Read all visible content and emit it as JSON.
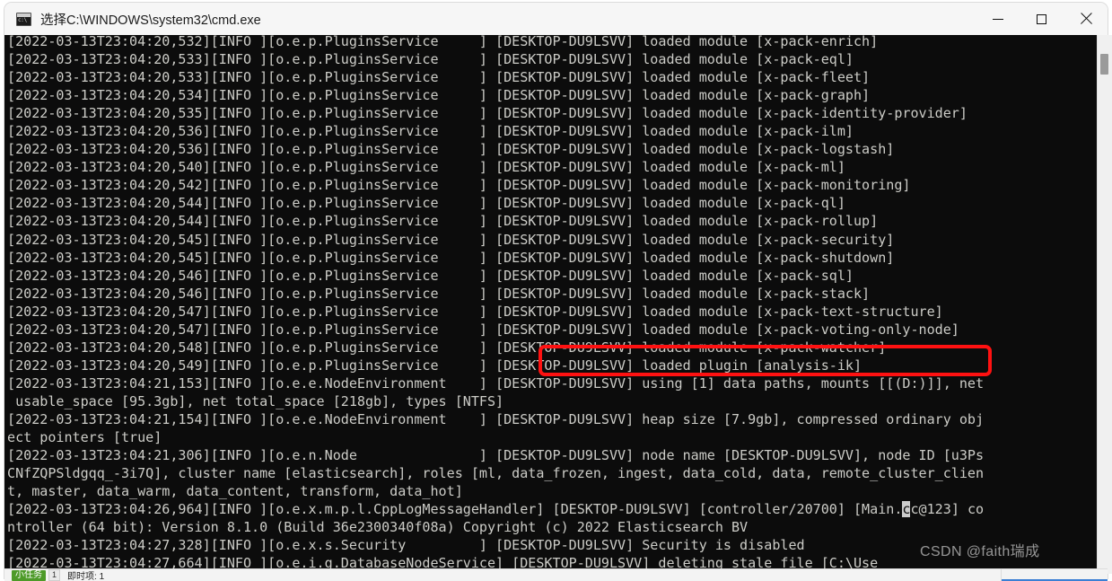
{
  "window": {
    "title": "选择C:\\WINDOWS\\system32\\cmd.exe",
    "icon": "cmd-icon",
    "controls": {
      "minimize_label": "Minimize",
      "maximize_label": "Maximize",
      "close_label": "Close"
    }
  },
  "colors": {
    "console_background": "#0c0c0c",
    "console_foreground": "#ccccc7",
    "titlebar_background": "#f6f6f6",
    "annotation_red": "#ff1111",
    "scrollbar_thumb": "#9a9a9a"
  },
  "annotation": {
    "type": "red-rectangle",
    "highlights_text": "[DESKTOP-DU9LSVV] loaded plugin [analysis-ik]",
    "color": "#ff1111"
  },
  "watermark": {
    "text": "CSDN @faith瑞成"
  },
  "scrollbar": {
    "position": "near-top",
    "thumb_top_pct": 4
  },
  "bottom_strip": {
    "status_label": "小任务",
    "count": "1",
    "items_label": "即时项: 1"
  },
  "console": {
    "hostname": "DESKTOP-DU9LSVV",
    "lines": [
      "[2022-03-13T23:04:20,532][INFO ][o.e.p.PluginsService     ] [DESKTOP-DU9LSVV] loaded module [x-pack-enrich]",
      "[2022-03-13T23:04:20,533][INFO ][o.e.p.PluginsService     ] [DESKTOP-DU9LSVV] loaded module [x-pack-eql]",
      "[2022-03-13T23:04:20,533][INFO ][o.e.p.PluginsService     ] [DESKTOP-DU9LSVV] loaded module [x-pack-fleet]",
      "[2022-03-13T23:04:20,534][INFO ][o.e.p.PluginsService     ] [DESKTOP-DU9LSVV] loaded module [x-pack-graph]",
      "[2022-03-13T23:04:20,535][INFO ][o.e.p.PluginsService     ] [DESKTOP-DU9LSVV] loaded module [x-pack-identity-provider]",
      "[2022-03-13T23:04:20,536][INFO ][o.e.p.PluginsService     ] [DESKTOP-DU9LSVV] loaded module [x-pack-ilm]",
      "[2022-03-13T23:04:20,536][INFO ][o.e.p.PluginsService     ] [DESKTOP-DU9LSVV] loaded module [x-pack-logstash]",
      "[2022-03-13T23:04:20,540][INFO ][o.e.p.PluginsService     ] [DESKTOP-DU9LSVV] loaded module [x-pack-ml]",
      "[2022-03-13T23:04:20,542][INFO ][o.e.p.PluginsService     ] [DESKTOP-DU9LSVV] loaded module [x-pack-monitoring]",
      "[2022-03-13T23:04:20,544][INFO ][o.e.p.PluginsService     ] [DESKTOP-DU9LSVV] loaded module [x-pack-ql]",
      "[2022-03-13T23:04:20,544][INFO ][o.e.p.PluginsService     ] [DESKTOP-DU9LSVV] loaded module [x-pack-rollup]",
      "[2022-03-13T23:04:20,545][INFO ][o.e.p.PluginsService     ] [DESKTOP-DU9LSVV] loaded module [x-pack-security]",
      "[2022-03-13T23:04:20,545][INFO ][o.e.p.PluginsService     ] [DESKTOP-DU9LSVV] loaded module [x-pack-shutdown]",
      "[2022-03-13T23:04:20,546][INFO ][o.e.p.PluginsService     ] [DESKTOP-DU9LSVV] loaded module [x-pack-sql]",
      "[2022-03-13T23:04:20,546][INFO ][o.e.p.PluginsService     ] [DESKTOP-DU9LSVV] loaded module [x-pack-stack]",
      "[2022-03-13T23:04:20,547][INFO ][o.e.p.PluginsService     ] [DESKTOP-DU9LSVV] loaded module [x-pack-text-structure]",
      "[2022-03-13T23:04:20,547][INFO ][o.e.p.PluginsService     ] [DESKTOP-DU9LSVV] loaded module [x-pack-voting-only-node]",
      "[2022-03-13T23:04:20,548][INFO ][o.e.p.PluginsService     ] [DESKTOP-DU9LSVV] loaded module [x-pack-watcher]",
      "[2022-03-13T23:04:20,549][INFO ][o.e.p.PluginsService     ] [DESKTOP-DU9LSVV] loaded plugin [analysis-ik]",
      "[2022-03-13T23:04:21,153][INFO ][o.e.e.NodeEnvironment    ] [DESKTOP-DU9LSVV] using [1] data paths, mounts [[(D:)]], net",
      " usable_space [95.3gb], net total_space [218gb], types [NTFS]",
      "[2022-03-13T23:04:21,154][INFO ][o.e.e.NodeEnvironment    ] [DESKTOP-DU9LSVV] heap size [7.9gb], compressed ordinary obj",
      "ect pointers [true]",
      "[2022-03-13T23:04:21,306][INFO ][o.e.n.Node               ] [DESKTOP-DU9LSVV] node name [DESKTOP-DU9LSVV], node ID [u3Ps",
      "CNfZQPSldgqq_-3i7Q], cluster name [elasticsearch], roles [ml, data_frozen, ingest, data_cold, data, remote_cluster_clien",
      "t, master, data_warm, data_content, transform, data_hot]",
      "[2022-03-13T23:04:26,964][INFO ][o.e.x.m.p.l.CppLogMessageHandler] [DESKTOP-DU9LSVV] [controller/20700] [Main.|cc@123] co",
      "ntroller (64 bit): Version 8.1.0 (Build 36e2300340f08a) Copyright (c) 2022 Elasticsearch BV",
      "[2022-03-13T23:04:27,328][INFO ][o.e.x.s.Security         ] [DESKTOP-DU9LSVV] Security is disabled",
      "[2022-03-13T23:04:27,664][INFO ][o.e.i.g.DatabaseNodeService] [DESKTOP-DU9LSVV] deleting stale file [C:\\Use"
    ]
  }
}
